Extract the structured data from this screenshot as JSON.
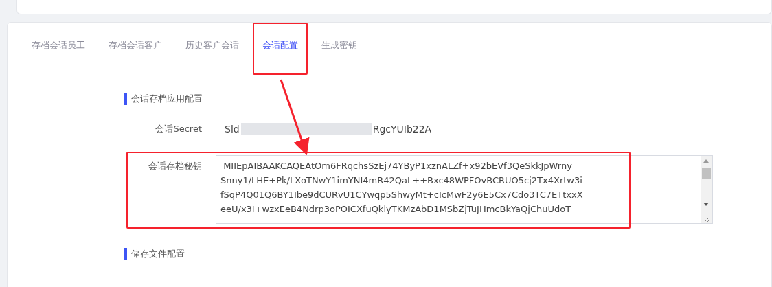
{
  "tabs": [
    {
      "label": "存档会话员工",
      "selected": false,
      "highlighted": false
    },
    {
      "label": "存档会话客户",
      "selected": false,
      "highlighted": false
    },
    {
      "label": "历史客户会话",
      "selected": false,
      "highlighted": false
    },
    {
      "label": "会话配置",
      "selected": true,
      "highlighted": true
    },
    {
      "label": "生成密钥",
      "selected": false,
      "highlighted": false
    }
  ],
  "sections": [
    {
      "title": "会话存档应用配置",
      "fields": [
        {
          "kind": "input",
          "label": "会话Secret",
          "value_start": "Sld",
          "value_end": "RgcYUIb22A",
          "redacted": true
        },
        {
          "kind": "textarea",
          "label": "会话存档秘钥",
          "lines": [
            " MIIEpAIBAAKCAQEAtOm6FRqchsSzEj74YByP1xznALZf+x92bEVf3QeSkkJpWrny",
            "Snny1/LHE+Pk/LXoTNwY1imYNI4mR42QaL++Bxc48WPFOvBCRUO5cj2Tx4Xrtw3i",
            "fSqP4Q01Q6BY1Ibe9dCURvU1CYwqp5ShwyMt+cIcMwF2y6E5Cx7Cdo3TC7ETtxxX",
            "eeU/x3I+wzxEeB4Ndrp3oPOICXfuQklyTKMzAbD1MSbZjTuJHmcBkYaQjChuUdoT"
          ],
          "highlighted": true
        }
      ]
    },
    {
      "title": "储存文件配置"
    }
  ]
}
